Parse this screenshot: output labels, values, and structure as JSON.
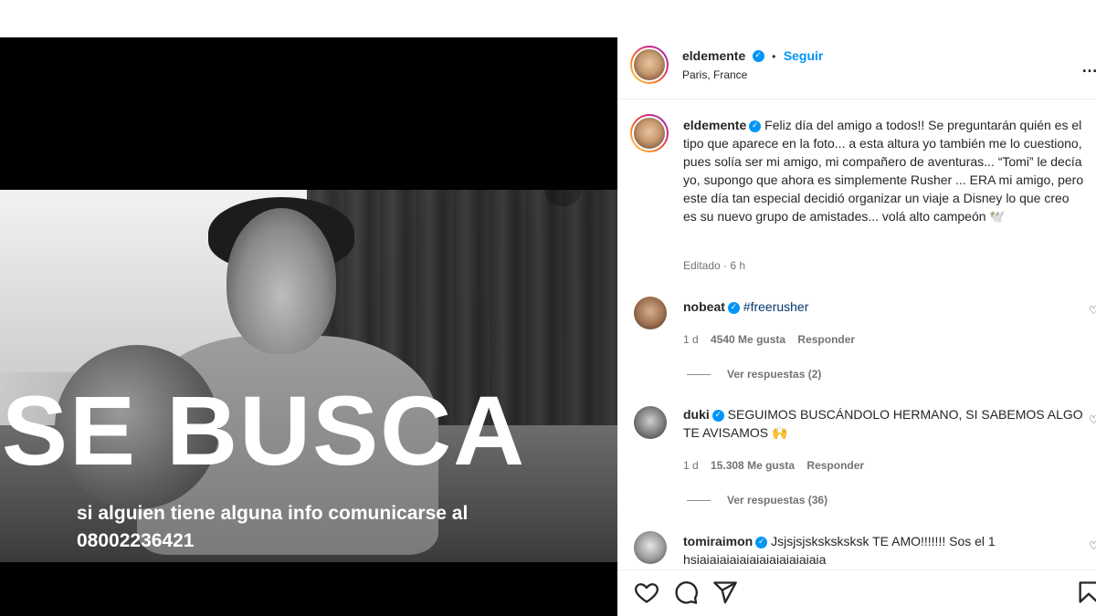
{
  "media": {
    "headline": "SE BUSCA",
    "subtext_line1": "si alguien tiene alguna info comunicarse al",
    "subtext_line2": "08002236421"
  },
  "post": {
    "author": "eldemente",
    "follow_label": "Seguir",
    "dot": "•",
    "location": "Paris, France",
    "caption": "Feliz día del amigo a todos!! Se preguntarán quién es el tipo que aparece en la foto... a esta altura yo también me lo cuestiono, pues solía ser mi amigo, mi compañero de aventuras... “Tomi” le decía yo, supongo que ahora es simplemente Rusher ... ERA mi amigo, pero este día tan especial decidió organizar un viaje a Disney lo que creo es su nuevo grupo de amistades... volá alto campeón 🕊️",
    "edited_meta": "Editado · 6 h"
  },
  "comments": [
    {
      "user": "nobeat",
      "text": "#freerusher",
      "time": "1 d",
      "likes": "4540 Me gusta",
      "reply_label": "Responder",
      "view_replies": "Ver respuestas (2)"
    },
    {
      "user": "duki",
      "text": "SEGUIMOS BUSCÁNDOLO HERMANO, SI SABEMOS ALGO TE AVISAMOS 🙌",
      "time": "1 d",
      "likes": "15.308 Me gusta",
      "reply_label": "Responder",
      "view_replies": "Ver respuestas (36)"
    },
    {
      "user": "tomiraimon",
      "text": "Jsjsjsjsksksksksk TE AMO!!!!!!! Sos el 1 hsiaiaiaiaiaiaiaiaiaiaiaiaia"
    }
  ],
  "icons": {
    "verified": "✓",
    "more": "…",
    "heart_small": "♡"
  }
}
